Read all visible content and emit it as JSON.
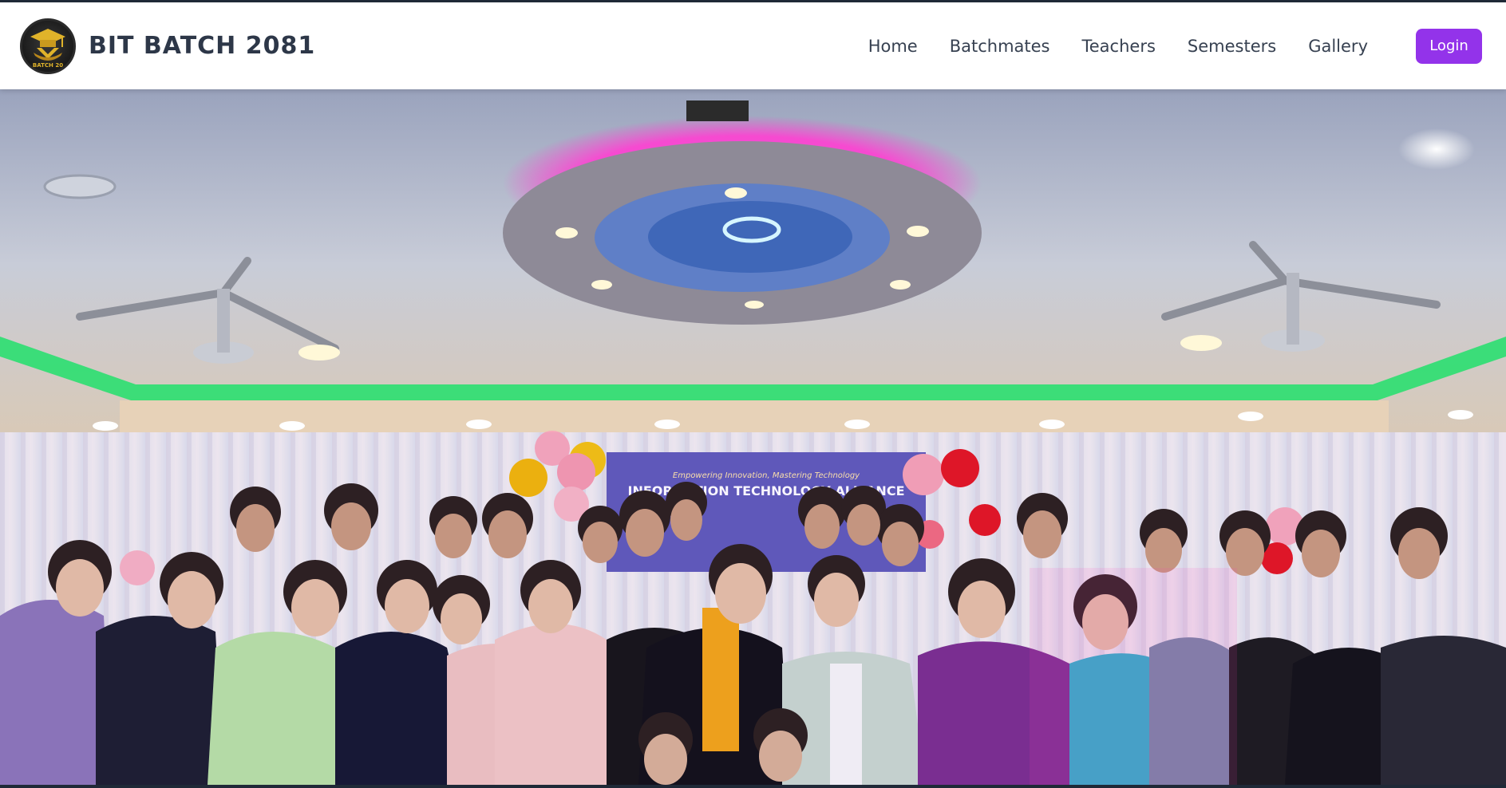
{
  "header": {
    "brand_title": "BIT BATCH 2081",
    "logo_text": "BATCH 20",
    "nav": [
      {
        "label": "Home"
      },
      {
        "label": "Batchmates"
      },
      {
        "label": "Teachers"
      },
      {
        "label": "Semesters"
      },
      {
        "label": "Gallery"
      }
    ],
    "login_label": "Login"
  },
  "hero": {
    "banner_tagline": "Empowering Innovation, Mastering Technology",
    "banner_title": "INFORMATION TECHNOLOGY ALLIANCE"
  },
  "colors": {
    "accent": "#9333ea",
    "brand_text": "#2d3748",
    "ceiling_pink": "#ff3fd2",
    "ceiling_green": "#21e06b"
  }
}
